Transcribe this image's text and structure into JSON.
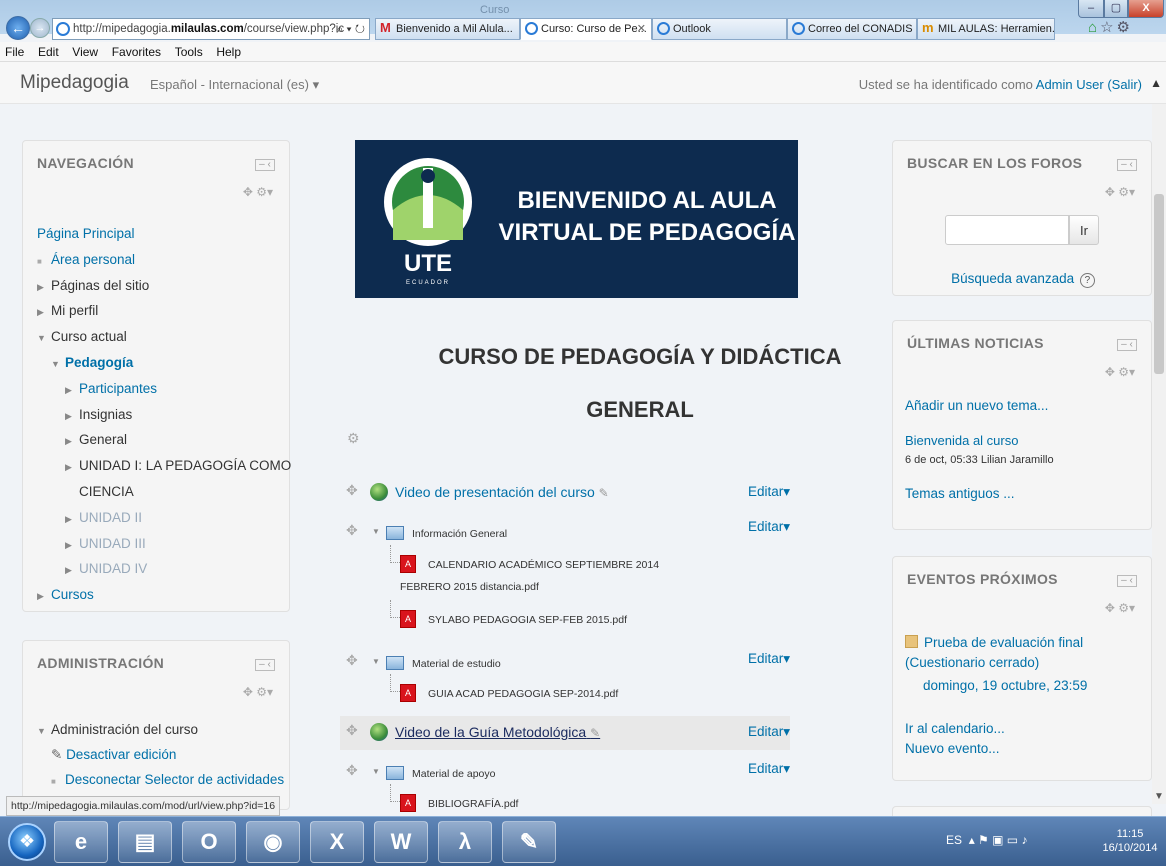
{
  "browser": {
    "address": {
      "prefix": "http://mipedagogia.",
      "domain": "milaulas.com",
      "suffix": "/course/view.php?ic"
    },
    "address_actions": "⌕ ▾ ↻",
    "tabs": [
      {
        "label": "Bienvenido a Mil Alula...",
        "icon": "gmail-icon"
      },
      {
        "label": "Curso: Curso de Pe...",
        "icon": "ie-icon",
        "active": true
      },
      {
        "label": "Outlook",
        "icon": "ie-icon"
      },
      {
        "label": "Correo del CONADIS (...",
        "icon": "ie-icon"
      },
      {
        "label": "MIL AULAS: Herramien...",
        "icon": "milaulas-icon"
      }
    ],
    "menu": [
      "File",
      "Edit",
      "View",
      "Favorites",
      "Tools",
      "Help"
    ],
    "status_url": "http://mipedagogia.milaulas.com/mod/url/view.php?id=16"
  },
  "header": {
    "brand": "Mipedagogia",
    "language": "Español - Internacional (es) ▾",
    "login_text": "Usted se ha identificado como ",
    "login_user": "Admin User",
    "logout": "(Salir)"
  },
  "navigation": {
    "title": "NAVEGACIÓN",
    "items": [
      "Página Principal",
      "Área personal",
      "Páginas del sitio",
      "Mi perfil",
      "Curso actual",
      "Pedagogía",
      "Participantes",
      "Insignias",
      "General",
      "UNIDAD I: LA PEDAGOGÍA COMO",
      "CIENCIA",
      "UNIDAD II",
      "UNIDAD III",
      "UNIDAD IV",
      "Cursos"
    ]
  },
  "admin": {
    "title": "ADMINISTRACIÓN",
    "items": [
      "Administración del curso",
      "Desactivar edición",
      "Desconectar Selector de actividades"
    ]
  },
  "search": {
    "title": "BUSCAR EN LOS FOROS",
    "button": "Ir",
    "advanced": "Búsqueda avanzada",
    "help": "?"
  },
  "news": {
    "title": "ÚLTIMAS NOTICIAS",
    "add": "Añadir un nuevo tema...",
    "item": "Bienvenida al curso",
    "meta": "6 de oct, 05:33  Lilian Jaramillo",
    "old": "Temas antiguos ..."
  },
  "events": {
    "title": "EVENTOS PRÓXIMOS",
    "event": "Prueba de evaluación final (Cuestionario cerrado)",
    "date": "domingo, 19 octubre, 23:59",
    "calendar": "Ir al calendario...",
    "new": "Nuevo evento..."
  },
  "banner": {
    "line1": "BIENVENIDO AL AULA",
    "line2": "VIRTUAL DE PEDAGOGÍA",
    "logo_ring": "UNIVERSIDAD TECNOLÓGICA EQUINOCCIAL",
    "logo_text": "UTE",
    "logo_sub": "ECUADOR"
  },
  "course": {
    "title1": "CURSO DE PEDAGOGÍA Y DIDÁCTICA",
    "title2": "GENERAL",
    "edit": "Editar▾",
    "rows": {
      "video1": "Video de presentación del curso",
      "info": "Información General",
      "pdf1a": "CALENDARIO ACADÉMICO SEPTIEMBRE 2014",
      "pdf1b": "FEBRERO 2015 distancia.pdf",
      "pdf2": "SYLABO PEDAGOGIA SEP-FEB 2015.pdf",
      "material": "Material de estudio",
      "pdf3": "GUIA ACAD PEDAGOGIA SEP-2014.pdf",
      "video2": "Video de la Guía Metodológica",
      "apoyo": "Material de apoyo",
      "pdf4": "BIBLIOGRAFÍA.pdf"
    }
  },
  "taskbar": {
    "tray": "ES",
    "time": "11:15",
    "date": "16/10/2014"
  }
}
